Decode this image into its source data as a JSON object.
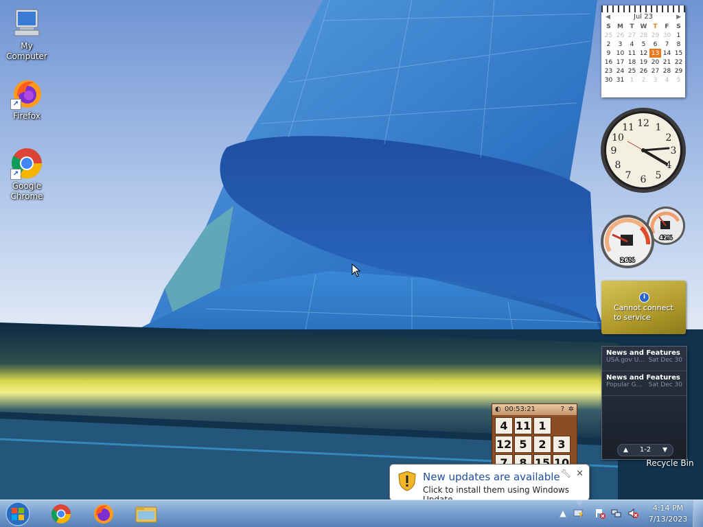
{
  "desktop": {
    "icons": [
      {
        "label": "My Computer"
      },
      {
        "label": "Firefox"
      },
      {
        "label": "Google Chrome"
      }
    ],
    "recycle_bin": "Recycle Bin"
  },
  "calendar": {
    "month": "Jul 23",
    "weekday_headers": [
      "S",
      "M",
      "T",
      "W",
      "T",
      "F",
      "S"
    ],
    "weeks": [
      [
        "25",
        "26",
        "27",
        "28",
        "29",
        "30",
        "1"
      ],
      [
        "2",
        "3",
        "4",
        "5",
        "6",
        "7",
        "8"
      ],
      [
        "9",
        "10",
        "11",
        "12",
        "13",
        "14",
        "15"
      ],
      [
        "16",
        "17",
        "18",
        "19",
        "20",
        "21",
        "22"
      ],
      [
        "23",
        "24",
        "25",
        "26",
        "27",
        "28",
        "29"
      ],
      [
        "30",
        "31",
        "1",
        "2",
        "3",
        "4",
        "5"
      ]
    ],
    "today": "13"
  },
  "clock": {
    "numerals": [
      "12",
      "1",
      "2",
      "3",
      "4",
      "5",
      "6",
      "7",
      "8",
      "9",
      "10",
      "11"
    ]
  },
  "cpu_meter": {
    "cpu_percent": "26%",
    "memory_percent": "42%",
    "cpu_value": 26,
    "memory_value": 42
  },
  "weather": {
    "message_line1": "Cannot connect",
    "message_line2": "to service"
  },
  "feeds": {
    "items": [
      {
        "title": "News and Features f...",
        "source": "USA.gov U...",
        "date": "Sat Dec 30"
      },
      {
        "title": "News and Features f...",
        "source": "Popular G...",
        "date": "Sat Dec 30"
      }
    ],
    "pager": "1-2"
  },
  "puzzle": {
    "timer": "00:53:21",
    "tiles": [
      "4",
      "11",
      "1",
      "",
      "12",
      "5",
      "2",
      "3",
      "7",
      "8",
      "15",
      "10"
    ]
  },
  "notification": {
    "title": "New updates are available",
    "body": "Click to install them using Windows Update."
  },
  "taskbar": {
    "time": "4:14 PM",
    "date": "7/13/2023"
  }
}
